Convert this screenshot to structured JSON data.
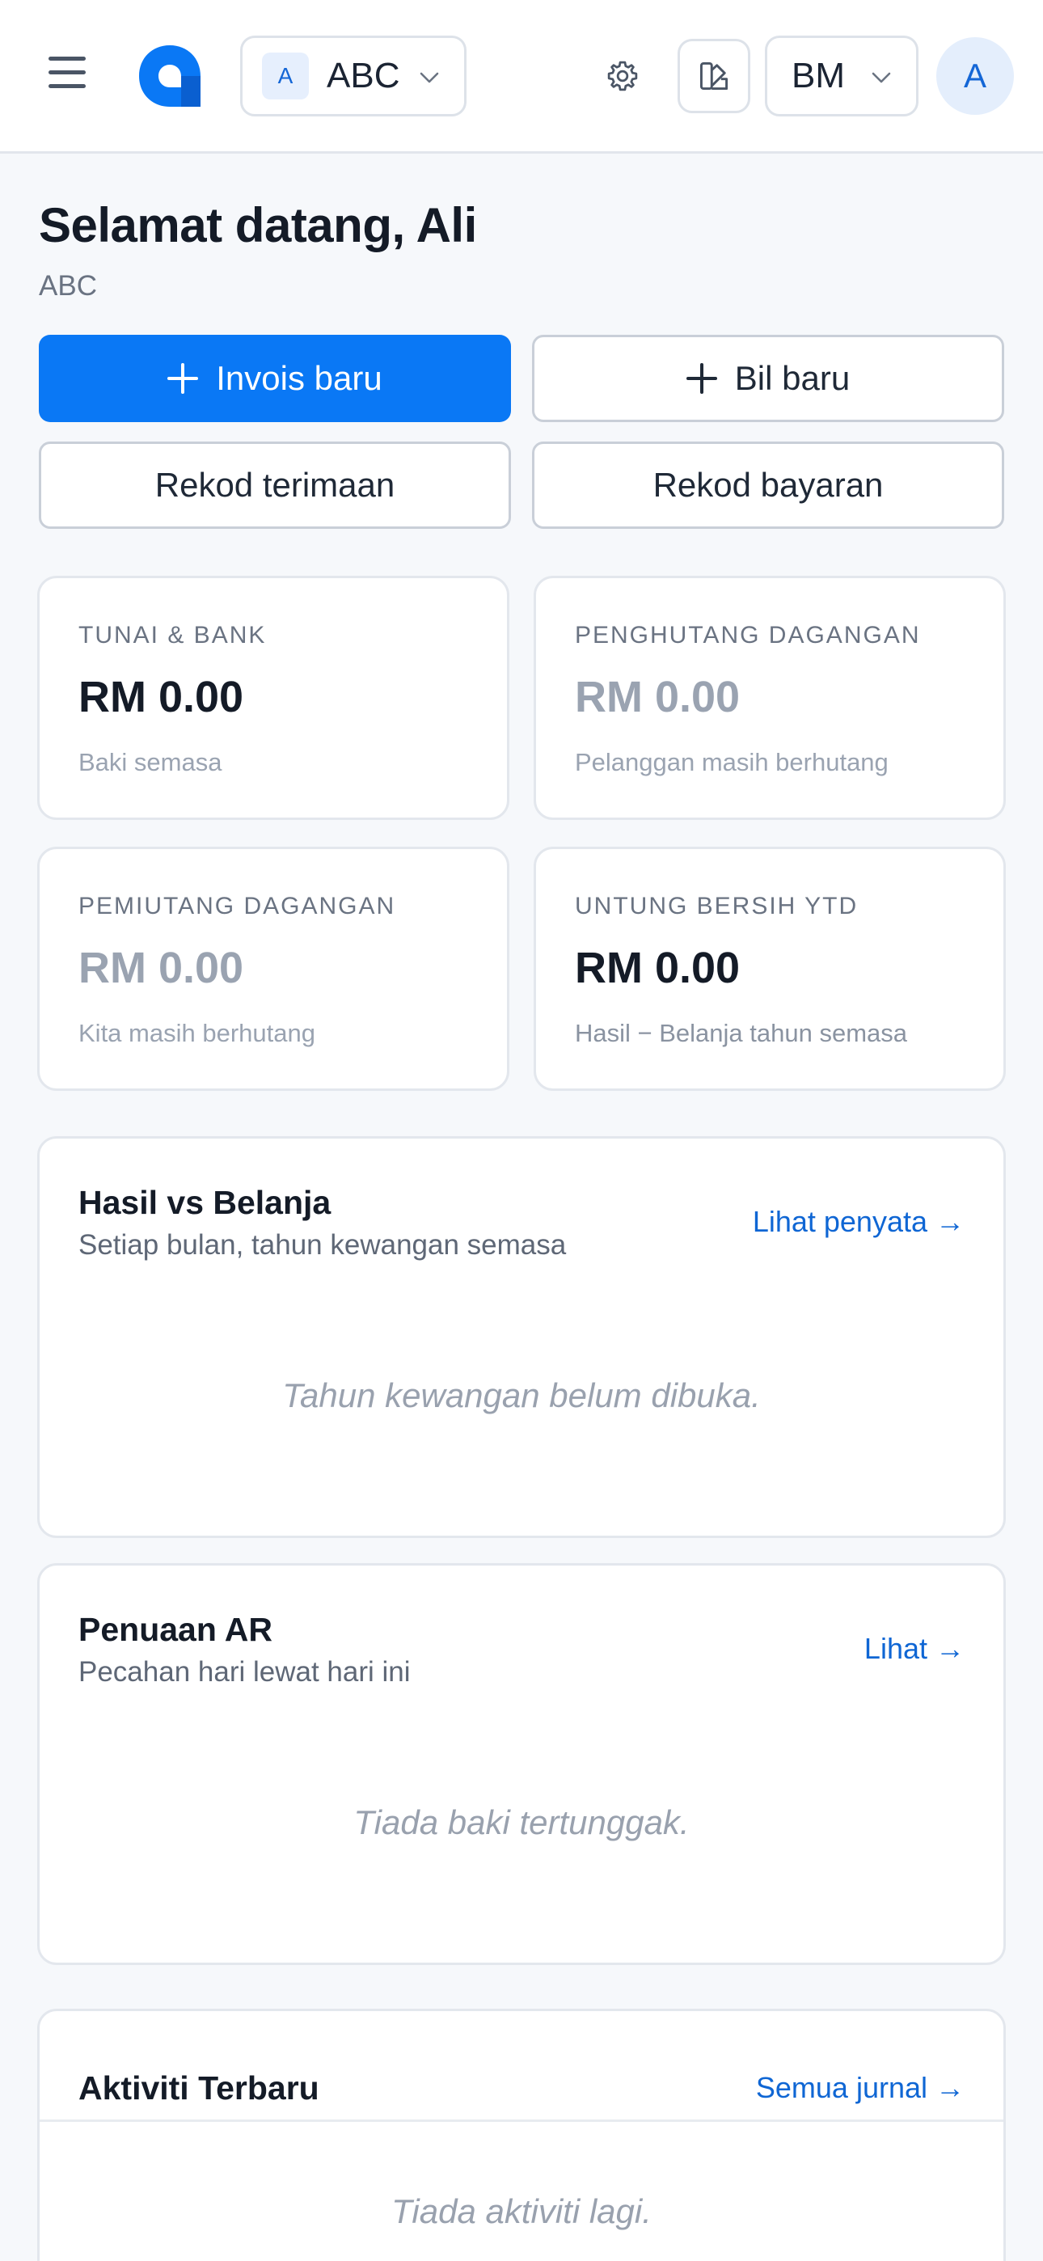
{
  "header": {
    "org_badge": "A",
    "org_name": "ABC",
    "language": "BM",
    "avatar_initial": "A"
  },
  "welcome": {
    "greeting": "Selamat datang, Ali",
    "org": "ABC"
  },
  "actions": {
    "new_invoice": "Invois baru",
    "new_bill": "Bil baru",
    "record_receipt": "Rekod terimaan",
    "record_payment": "Rekod bayaran"
  },
  "stats": [
    {
      "label": "TUNAI & BANK",
      "value": "RM 0.00",
      "sub": "Baki semasa"
    },
    {
      "label": "PENGHUTANG DAGANGAN",
      "value": "RM 0.00",
      "sub": "Pelanggan masih berhutang"
    },
    {
      "label": "PEMIUTANG DAGANGAN",
      "value": "RM 0.00",
      "sub": "Kita masih berhutang"
    },
    {
      "label": "UNTUNG BERSIH YTD",
      "value": "RM 0.00",
      "sub": "Hasil − Belanja tahun semasa"
    }
  ],
  "income_expense": {
    "title": "Hasil vs Belanja",
    "subtitle": "Setiap bulan, tahun kewangan semasa",
    "link": "Lihat penyata →",
    "empty": "Tahun kewangan belum dibuka."
  },
  "ar_aging": {
    "title": "Penuaan AR",
    "subtitle": "Pecahan hari lewat hari ini",
    "link": "Lihat →",
    "empty": "Tiada baki tertunggak."
  },
  "recent_activity": {
    "title": "Aktiviti Terbaru",
    "link": "Semua jurnal →",
    "empty": "Tiada aktiviti lagi."
  },
  "colors": {
    "primary": "#0a78f5",
    "link": "#0f66d4",
    "muted_value": "#9aa3b1"
  }
}
